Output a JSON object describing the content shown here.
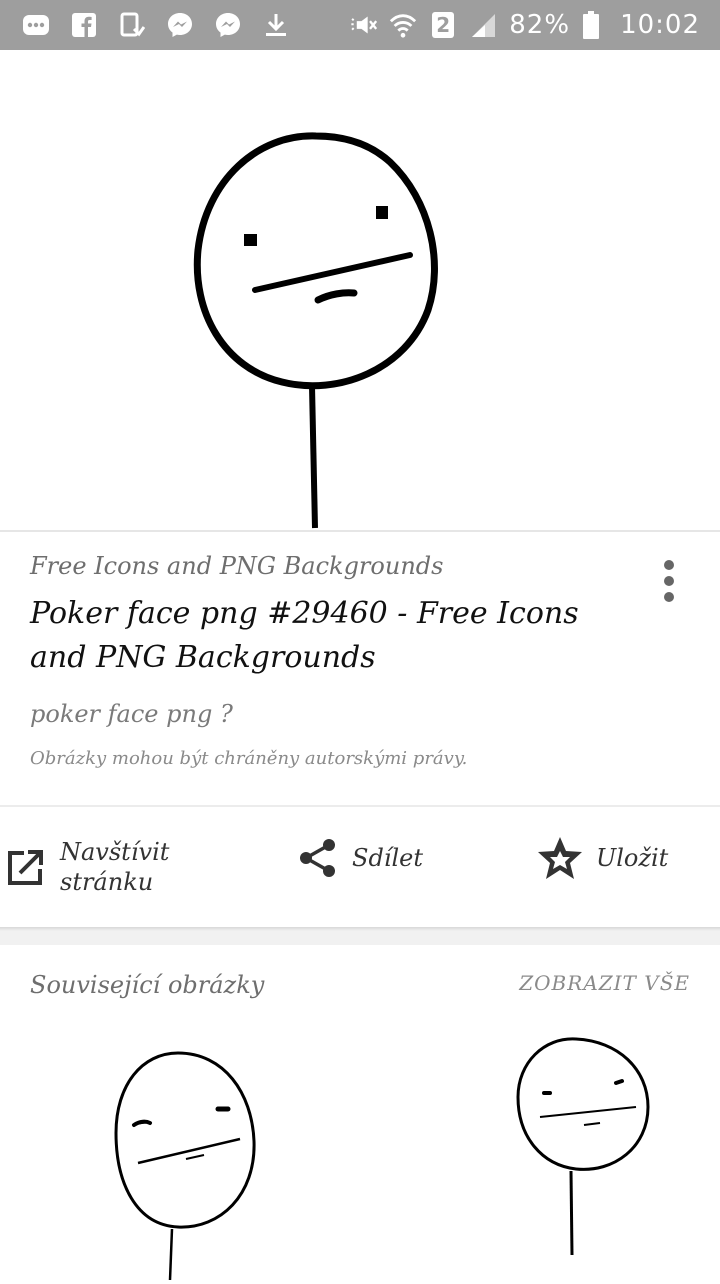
{
  "status_bar": {
    "battery": "82%",
    "time": "10:02",
    "sim": "2",
    "icons": [
      "more-icon",
      "facebook-icon",
      "device-icon",
      "messenger-icon",
      "messenger-icon",
      "download-icon",
      "mute-icon",
      "wifi-icon",
      "sim-icon",
      "signal-icon",
      "battery-icon"
    ]
  },
  "result": {
    "source": "Free Icons and PNG Backgrounds",
    "title": "Poker face png #29460 - Free Icons and PNG Backgrounds",
    "query": "poker face png ?",
    "copyright": "Obrázky mohou být chráněny autorskými právy."
  },
  "actions": {
    "visit": "Navštívit stránku",
    "share": "Sdílet",
    "save": "Uložit"
  },
  "related": {
    "title": "Související obrázky",
    "see_all": "ZOBRAZIT VŠE"
  }
}
